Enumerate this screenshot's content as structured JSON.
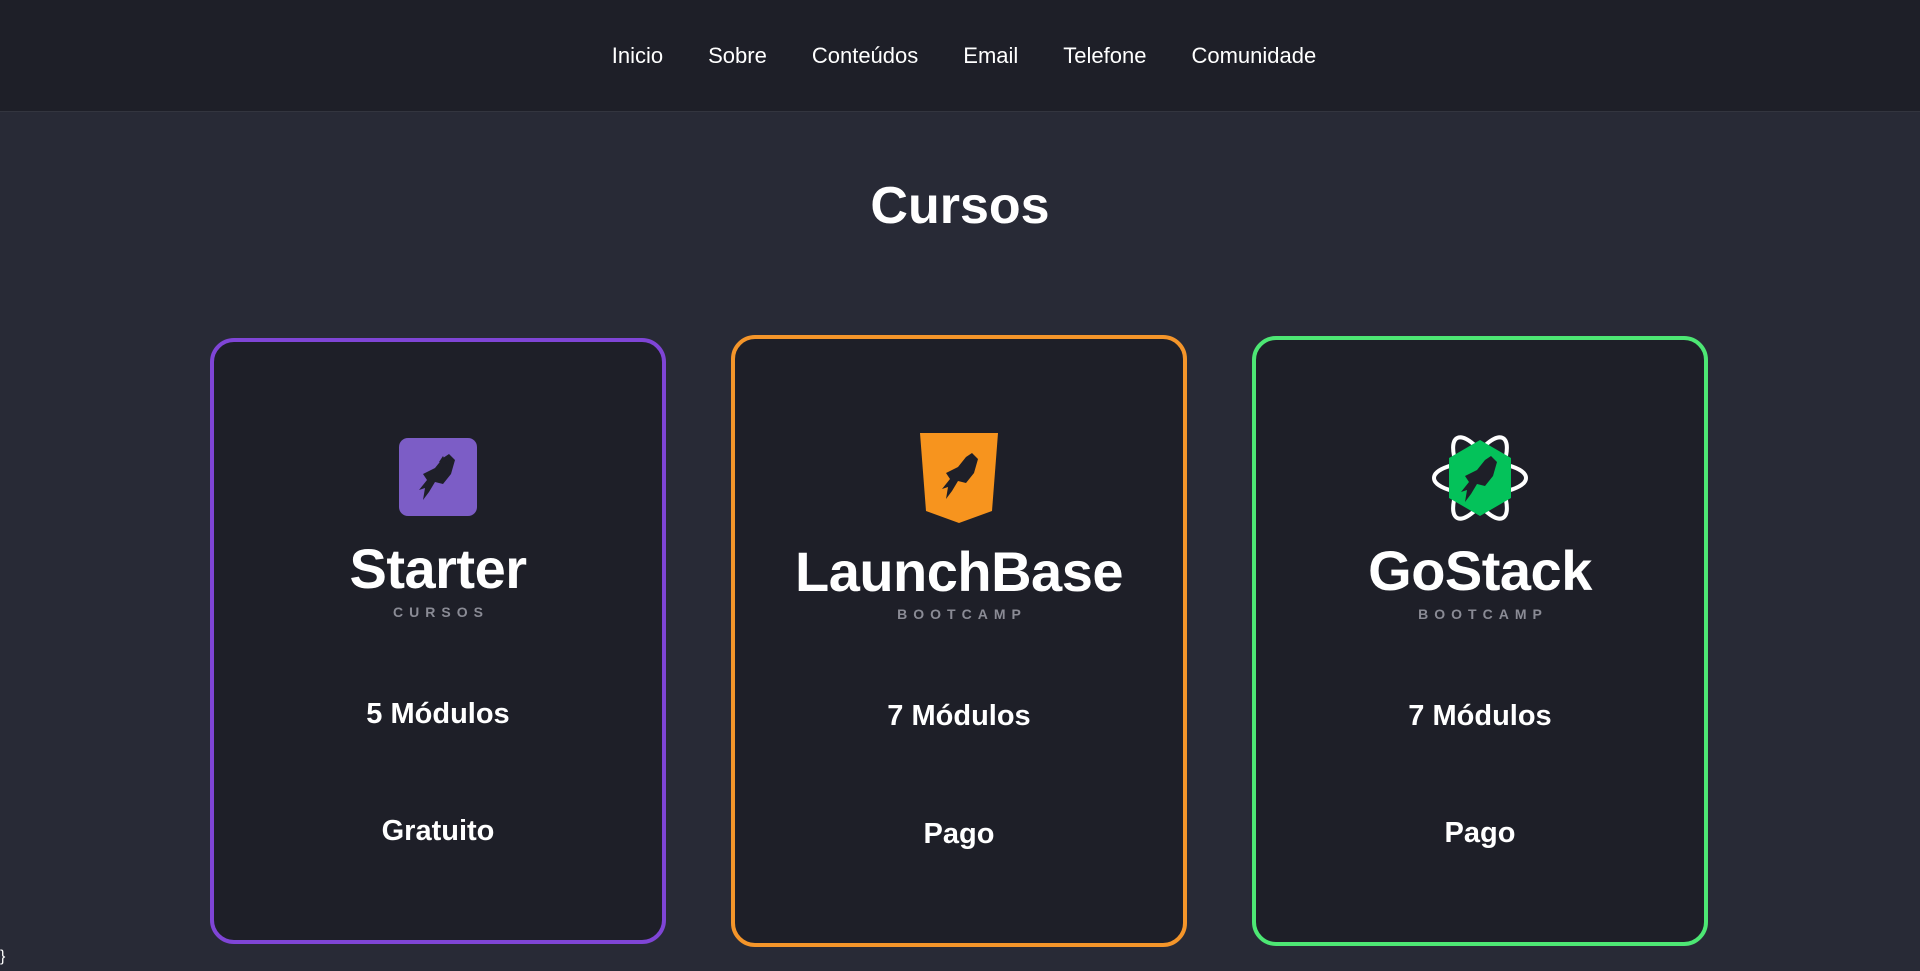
{
  "nav": {
    "items": [
      "Inicio",
      "Sobre",
      "Conteúdos",
      "Email",
      "Telefone",
      "Comunidade"
    ]
  },
  "page": {
    "title": "Cursos",
    "stray_text": "}"
  },
  "cards": [
    {
      "brand": "Starter",
      "subtitle": "CURSOS",
      "modules": "5 Módulos",
      "price": "Gratuito",
      "accent": "#7f45d6",
      "logo_color": "#7c5dc6",
      "icon": "rocket-square-icon"
    },
    {
      "brand": "LaunchBase",
      "subtitle": "BOOTCAMP",
      "modules": "7 Módulos",
      "price": "Pago",
      "accent": "#f4952a",
      "logo_color": "#f7941e",
      "icon": "rocket-shield-icon"
    },
    {
      "brand": "GoStack",
      "subtitle": "BOOTCAMP",
      "modules": "7 Módulos",
      "price": "Pago",
      "accent": "#4de774",
      "logo_color": "#04c25a",
      "icon": "rocket-atom-icon"
    }
  ]
}
